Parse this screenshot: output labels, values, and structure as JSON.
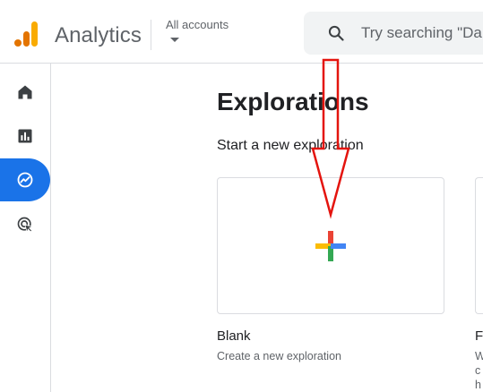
{
  "header": {
    "app_title": "Analytics",
    "account_label": "All accounts",
    "search_placeholder": "Try searching \"Da"
  },
  "sidenav": {
    "items": [
      {
        "name": "Home",
        "icon": "home-icon"
      },
      {
        "name": "Reports",
        "icon": "reports-icon"
      },
      {
        "name": "Explore",
        "icon": "explore-icon",
        "active": true
      },
      {
        "name": "Advertising",
        "icon": "advertising-icon"
      }
    ]
  },
  "main": {
    "title": "Explorations",
    "subtitle": "Start a new exploration",
    "templates": [
      {
        "title": "Blank",
        "description": "Create a new exploration"
      },
      {
        "title": "Fr",
        "description": "W ch"
      }
    ]
  },
  "colors": {
    "accent": "#1a73e8",
    "logo_orange": "#f9ab00",
    "logo_dark_orange": "#e37400",
    "annotation_red": "#e4140e",
    "plus_red": "#ea4335",
    "plus_yellow": "#fbbc04",
    "plus_green": "#34a853",
    "plus_blue": "#4285f4"
  }
}
